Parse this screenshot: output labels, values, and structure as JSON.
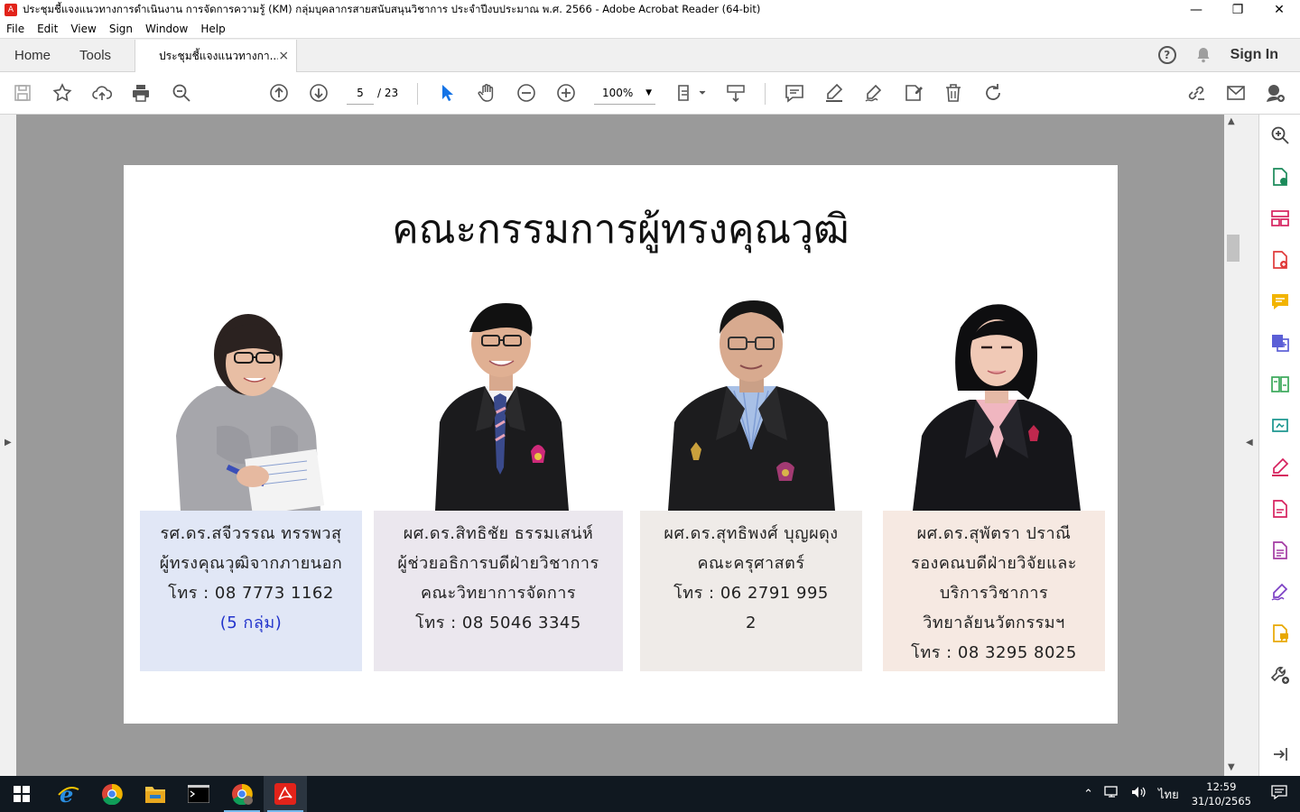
{
  "window": {
    "title": "ประชุมชี้แจงแนวทางการดำเนินงาน การจัดการความรู้ (KM)  กลุ่มบุคลากรสายสนับสนุนวิชาการ  ประจำปีงบประมาณ พ.ศ. 2566 - Adobe Acrobat Reader (64-bit)",
    "minimize": "—",
    "restore": "❐",
    "close": "✕"
  },
  "menu": [
    "File",
    "Edit",
    "View",
    "Sign",
    "Window",
    "Help"
  ],
  "tabs": {
    "home": "Home",
    "tools": "Tools",
    "document": "ประชุมชี้แจงแนวทางกา...",
    "close": "×",
    "sign_in": "Sign In",
    "help": "?"
  },
  "toolbar": {
    "page_current": "5",
    "page_total": "/ 23",
    "zoom": "100%"
  },
  "page": {
    "title": "คณะกรรมการผู้ทรงคุณวุฒิ",
    "members": [
      {
        "name": "รศ.ดร.สจีวรรณ  ทรรพวสุ",
        "role": "ผู้ทรงคุณวุฒิจากภายนอก",
        "phone": "โทร : 08 7773 1162",
        "note": "(5 กลุ่ม)",
        "bg": "#e1e7f6"
      },
      {
        "name": "ผศ.ดร.สิทธิชัย  ธรรมเสน่ห์",
        "role": "ผู้ช่วยอธิการบดีฝ่ายวิชาการ",
        "dept": "คณะวิทยาการจัดการ",
        "phone": "โทร : 08 5046 3345",
        "bg": "#ebe7ee"
      },
      {
        "name": "ผศ.ดร.สุทธิพงศ์  บุญผดุง",
        "role": "คณะครุศาสตร์",
        "phone": "โทร : 06 2791 995",
        "phone2": "2",
        "bg": "#efebe8"
      },
      {
        "name": "ผศ.ดร.สุพัตรา  ปราณี",
        "role": "รองคณบดีฝ่ายวิจัยและ",
        "role2": "บริการวิชาการ",
        "dept": "วิทยาลัยนวัตกรรมฯ",
        "phone": "โทร : 08 3295 8025",
        "bg": "#f6e9e2"
      }
    ]
  },
  "taskbar": {
    "clock_time": "12:59",
    "clock_date": "31/10/2565",
    "language": "ไทย"
  },
  "colors": {
    "accent_red": "#e2231a",
    "tool_blue": "#1473e6",
    "taskbar": "#101820",
    "doc_bg": "#9a9a9a"
  }
}
